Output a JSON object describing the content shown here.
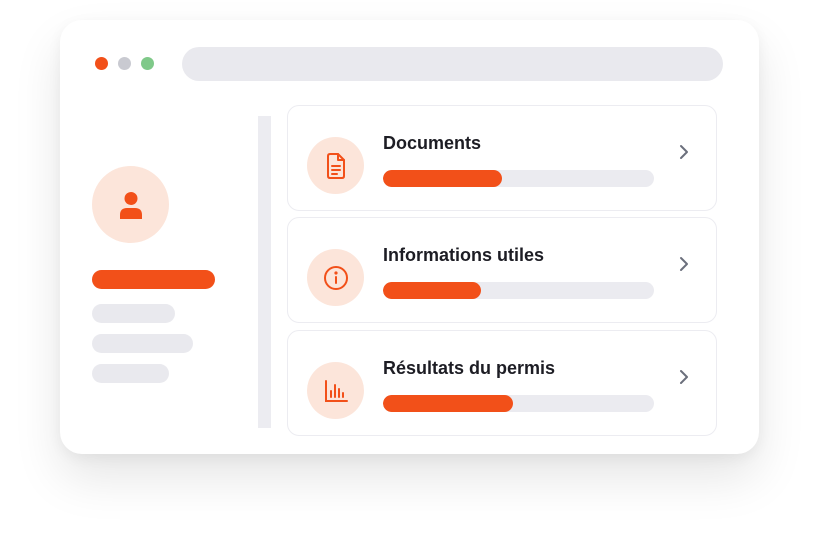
{
  "colors": {
    "accent": "#f25019",
    "accent_soft": "#fce5da",
    "dot_red": "#f25019",
    "dot_gray": "#c9cad1",
    "dot_green": "#7fc989",
    "placeholder": "#e9e9ee",
    "track": "#ebebf0",
    "chevron": "#6b6f7c"
  },
  "window": {
    "controls": [
      {
        "name": "close",
        "color": "#f25019"
      },
      {
        "name": "minimize",
        "color": "#c9cad1"
      },
      {
        "name": "maximize",
        "color": "#7fc989"
      }
    ]
  },
  "sidebar": {
    "avatar_icon": "user-icon",
    "items": [
      {
        "active": true
      },
      {
        "active": false
      },
      {
        "active": false
      },
      {
        "active": false
      }
    ]
  },
  "cards": [
    {
      "title": "Documents",
      "icon": "document-icon",
      "progress": 0.44
    },
    {
      "title": "Informations utiles",
      "icon": "info-icon",
      "progress": 0.36
    },
    {
      "title": "Résultats du permis",
      "icon": "bar-chart-icon",
      "progress": 0.48
    }
  ]
}
